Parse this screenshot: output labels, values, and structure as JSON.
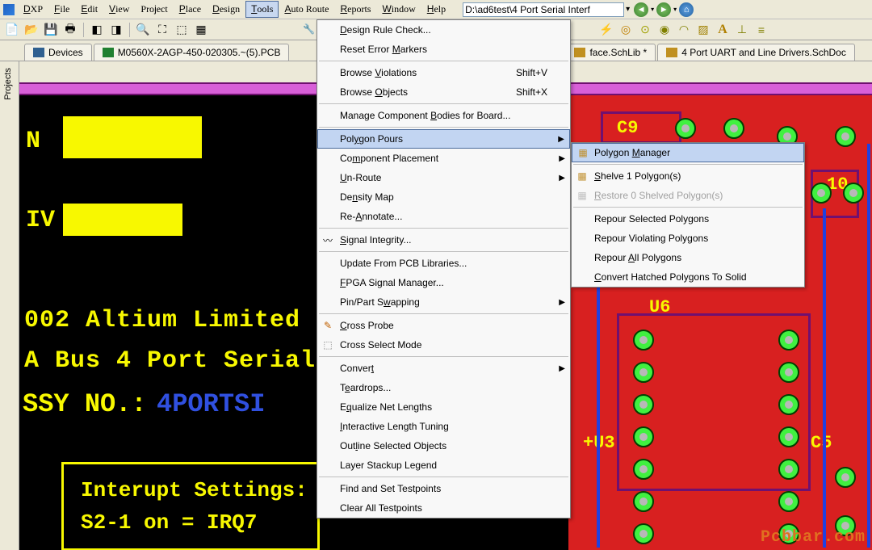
{
  "menubar": {
    "app": "DXP",
    "items": [
      "File",
      "Edit",
      "View",
      "Project",
      "Place",
      "Design",
      "Tools",
      "Auto Route",
      "Reports",
      "Window",
      "Help"
    ],
    "path": "D:\\ad6test\\4 Port Serial Interf"
  },
  "tabs": [
    {
      "icon": "dev",
      "label": "Devices"
    },
    {
      "icon": "pcb",
      "label": "M0560X-2AGP-450-020305.~(5).PCB"
    },
    {
      "icon": "sch",
      "label": "face.SchLib *"
    },
    {
      "icon": "sch",
      "label": "4 Port UART and Line Drivers.SchDoc"
    }
  ],
  "sidebar": {
    "label": "Projects"
  },
  "pcb_left": {
    "copyright": "002 Altium Limited",
    "product": "A Bus 4 Port Serial",
    "assy": "SSY NO.:",
    "assy_blue": "4PORTSI",
    "box_line1": "Interupt Settings:",
    "box_line2": "S2-1 on = IRQ7"
  },
  "pcb_right": {
    "ref": [
      "C9",
      "10",
      "U6",
      "+U3",
      "C5"
    ]
  },
  "watermark": "Pcbbar.com",
  "tools_menu": [
    {
      "t": "item",
      "label": "Design Rule Check..."
    },
    {
      "t": "item",
      "label": "Reset Error Markers"
    },
    {
      "t": "sep"
    },
    {
      "t": "item",
      "label": "Browse Violations",
      "shortcut": "Shift+V"
    },
    {
      "t": "item",
      "label": "Browse Objects",
      "shortcut": "Shift+X"
    },
    {
      "t": "sep"
    },
    {
      "t": "item",
      "label": "Manage Component Bodies for Board..."
    },
    {
      "t": "sep"
    },
    {
      "t": "item",
      "label": "Polygon Pours",
      "sub": true,
      "hover": true
    },
    {
      "t": "item",
      "label": "Component Placement",
      "sub": true
    },
    {
      "t": "item",
      "label": "Un-Route",
      "sub": true
    },
    {
      "t": "item",
      "label": "Density Map"
    },
    {
      "t": "item",
      "label": "Re-Annotate..."
    },
    {
      "t": "sep"
    },
    {
      "t": "item",
      "label": "Signal Integrity...",
      "icon": "sig"
    },
    {
      "t": "sep"
    },
    {
      "t": "item",
      "label": "Update From PCB Libraries..."
    },
    {
      "t": "item",
      "label": "FPGA Signal Manager..."
    },
    {
      "t": "item",
      "label": "Pin/Part Swapping",
      "sub": true
    },
    {
      "t": "sep"
    },
    {
      "t": "item",
      "label": "Cross Probe",
      "icon": "probe"
    },
    {
      "t": "item",
      "label": "Cross Select Mode",
      "icon": "csel"
    },
    {
      "t": "sep"
    },
    {
      "t": "item",
      "label": "Convert",
      "sub": true
    },
    {
      "t": "item",
      "label": "Teardrops..."
    },
    {
      "t": "item",
      "label": "Equalize Net Lengths"
    },
    {
      "t": "item",
      "label": "Interactive Length Tuning"
    },
    {
      "t": "item",
      "label": "Outline Selected Objects"
    },
    {
      "t": "item",
      "label": "Layer Stackup Legend"
    },
    {
      "t": "sep"
    },
    {
      "t": "item",
      "label": "Find and Set Testpoints"
    },
    {
      "t": "item",
      "label": "Clear All Testpoints"
    }
  ],
  "polygon_menu": [
    {
      "t": "item",
      "label": "Polygon Manager",
      "icon": "pm",
      "hover": true
    },
    {
      "t": "sep"
    },
    {
      "t": "item",
      "label": "Shelve 1 Polygon(s)",
      "icon": "shelve"
    },
    {
      "t": "item",
      "label": "Restore 0 Shelved Polygon(s)",
      "icon": "restore",
      "disabled": true
    },
    {
      "t": "sep"
    },
    {
      "t": "item",
      "label": "Repour Selected Polygons"
    },
    {
      "t": "item",
      "label": "Repour Violating Polygons"
    },
    {
      "t": "item",
      "label": "Repour All Polygons"
    },
    {
      "t": "item",
      "label": "Convert Hatched Polygons To Solid"
    }
  ]
}
